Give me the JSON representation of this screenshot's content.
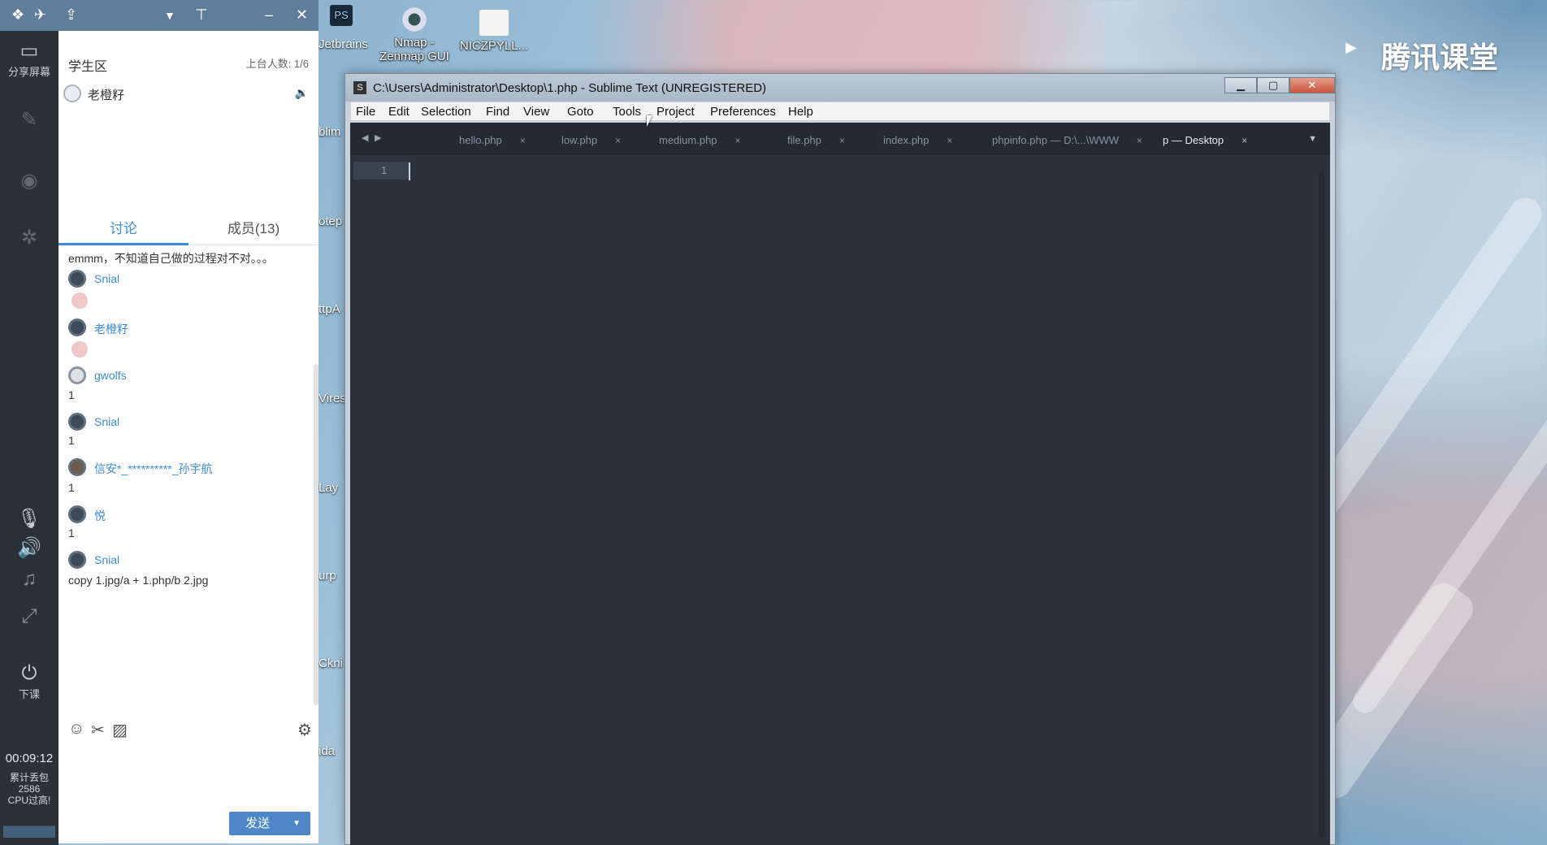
{
  "brand": {
    "name": "腾讯课堂"
  },
  "left_toolbar": {
    "share_screen": "分享屏幕",
    "end_class": "下课",
    "timer": "00:09:12",
    "stats": [
      "累计丢包",
      "2586",
      "CPU过高!"
    ]
  },
  "chat": {
    "header_title": "学生区",
    "online_count": "上台人数: 1/6",
    "teacher_name": "老橙籽",
    "tabs": [
      {
        "label": "讨论"
      },
      {
        "label": "成员(13)"
      }
    ],
    "messages": {
      "m0": "emmm，不知道自己做的过程对不对。。。",
      "u1": "Snial",
      "u2": "老橙籽",
      "u3": "gwolfs",
      "t3": "1",
      "u4": "Snial",
      "t4": "1",
      "u5": "信安*_**********_孙宇航",
      "t5": "1",
      "u6": "悦",
      "t6": "1",
      "u7": "Snial",
      "t7": "copy 1.jpg/a + 1.php/b 2.jpg"
    },
    "send_label": "发送"
  },
  "desktop": {
    "icons": [
      "Nmap - Zenmap GUI",
      "NICZPYLL..."
    ],
    "side_labels": [
      "Jetbrains",
      "blim",
      "otep",
      "ttpA",
      "Vires",
      "Lay",
      "urp",
      "Ckni",
      "ida"
    ],
    "ps_label": "PS"
  },
  "sublime": {
    "title": "C:\\Users\\Administrator\\Desktop\\1.php - Sublime Text (UNREGISTERED)",
    "menu": [
      "File",
      "Edit",
      "Selection",
      "Find",
      "View",
      "Goto",
      "Tools",
      "Project",
      "Preferences",
      "Help"
    ],
    "tabs": [
      "hello.php",
      "low.php",
      "medium.php",
      "file.php",
      "index.php",
      "phpinfo.php — D:\\...\\WWW",
      "p — Desktop"
    ],
    "close_glyph": "×",
    "line_number": "1"
  },
  "colors": {
    "accent": "#3d8bd8",
    "editor_bg": "#2b323b",
    "toolbar_bg": "#2a3138"
  }
}
